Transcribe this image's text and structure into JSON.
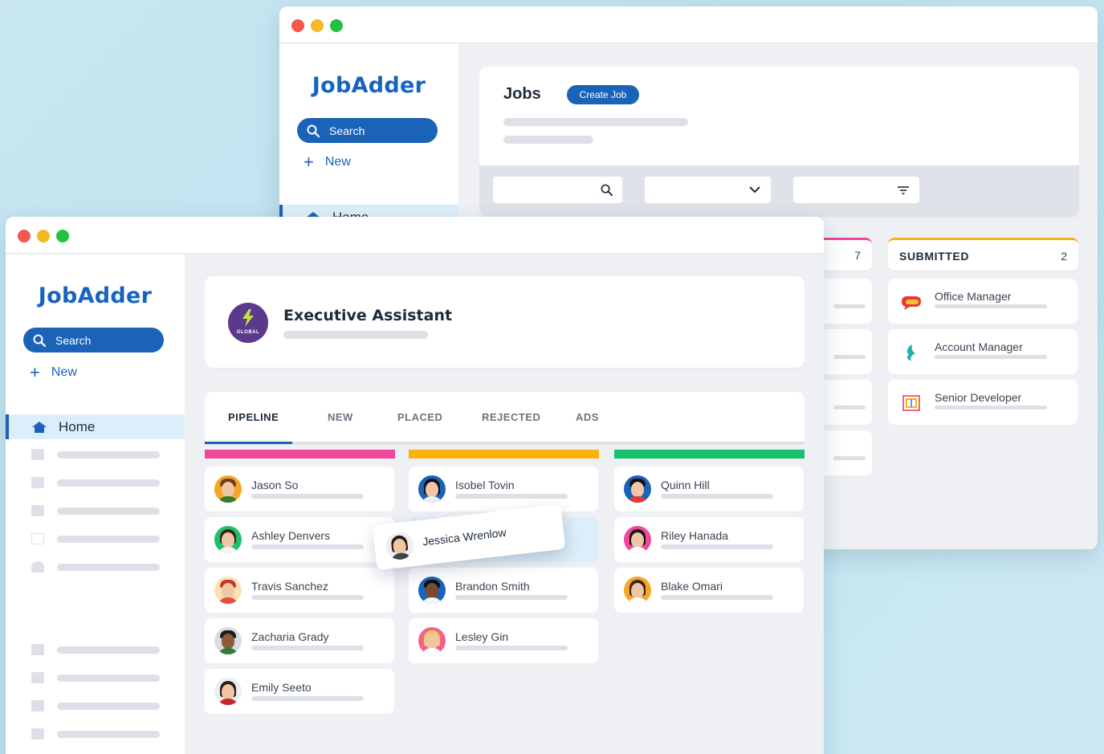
{
  "back_window": {
    "logo": "JobAdder",
    "search_label": "Search",
    "new_label": "New",
    "home_label": "Home",
    "jobs_title": "Jobs",
    "create_job_label": "Create Job",
    "count_left": "7",
    "submitted": {
      "label": "SUBMITTED",
      "count": "2"
    },
    "jobs": [
      {
        "title": "Office Manager",
        "icon": "chat-bubble-logo-icon"
      },
      {
        "title": "Account Manager",
        "icon": "leaf-logo-icon"
      },
      {
        "title": "Senior Developer",
        "icon": "maze-logo-icon"
      }
    ]
  },
  "front_window": {
    "logo": "JobAdder",
    "search_label": "Search",
    "new_label": "New",
    "home_label": "Home",
    "job_title": "Executive Assistant",
    "company_badge": "GLOBAL",
    "tabs": [
      "PIPELINE",
      "NEW",
      "PLACED",
      "REJECTED",
      "ADS"
    ],
    "active_tab": "PIPELINE",
    "columns": [
      {
        "color": "#f0479b",
        "candidates": [
          "Jason So",
          "Ashley Denvers",
          "Travis Sanchez",
          "Zacharia Grady",
          "Emily Seeto"
        ]
      },
      {
        "color": "#f9b10f",
        "candidates": [
          "Isobel Tovin",
          "",
          "Brandon Smith",
          "Lesley Gin"
        ]
      },
      {
        "color": "#18c16e",
        "candidates": [
          "Quinn Hill",
          "Riley Hanada",
          "Blake Omari"
        ]
      }
    ],
    "dragged_candidate": "Jessica Wrenlow"
  },
  "colors": {
    "brand": "#1565c0",
    "submitted_accent": "#f9b10f",
    "left_column_accent": "#f0479b"
  }
}
